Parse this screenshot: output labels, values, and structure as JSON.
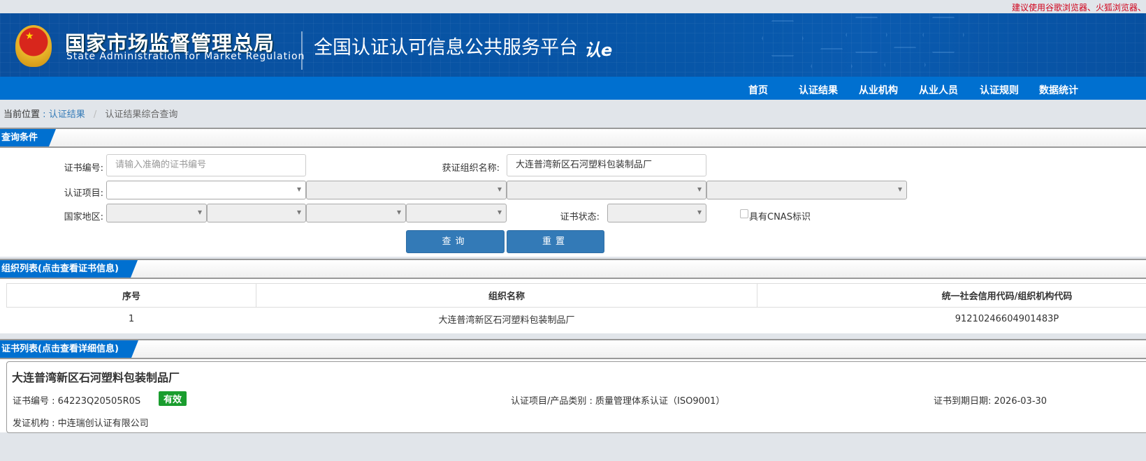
{
  "notice": "建议使用谷歌浏览器、火狐浏览器、",
  "header": {
    "title_cn": "国家市场监督管理总局",
    "title_en": "State Administration  for  Market Regulation",
    "platform": "全国认证认可信息公共服务平台",
    "logo_text": "认e云",
    "emblem_icon": "national-emblem"
  },
  "nav": [
    "首页",
    "认证结果",
    "从业机构",
    "从业人员",
    "认证规则",
    "数据统计"
  ],
  "breadcrumb": {
    "prefix": "当前位置",
    "sep1": ":",
    "link": "认证结果",
    "sep2": "/",
    "current": "认证结果综合查询"
  },
  "query": {
    "section_title": "查询条件",
    "cert_no_label": "证书编号:",
    "cert_no_placeholder": "请输入准确的证书编号",
    "org_label": "获证组织名称:",
    "org_value": "大连普湾新区石河塑料包装制品厂",
    "project_label": "认证项目:",
    "region_label": "国家地区:",
    "status_label": "证书状态:",
    "cnas_label": "具有CNAS标识",
    "search_btn": "查询",
    "reset_btn": "重置"
  },
  "org_list": {
    "section_title": "组织列表(点击查看证书信息)",
    "columns": [
      "序号",
      "组织名称",
      "统一社会信用代码/组织机构代码"
    ],
    "rows": [
      {
        "index": "1",
        "name": "大连普湾新区石河塑料包装制品厂",
        "code": "91210246604901483P"
      }
    ]
  },
  "cert_list": {
    "section_title": "证书列表(点击查看详细信息)",
    "org_name": "大连普湾新区石河塑料包装制品厂",
    "cert_no": "证书编号 : 64223Q20505R0S",
    "status": "有效",
    "status_color": "#1a9d2e",
    "category": "认证项目/产品类别 : 质量管理体系认证（ISO9001）",
    "expiry": "证书到期日期: 2026-03-30",
    "issuer": "发证机构 : 中连瑞创认证有限公司"
  }
}
